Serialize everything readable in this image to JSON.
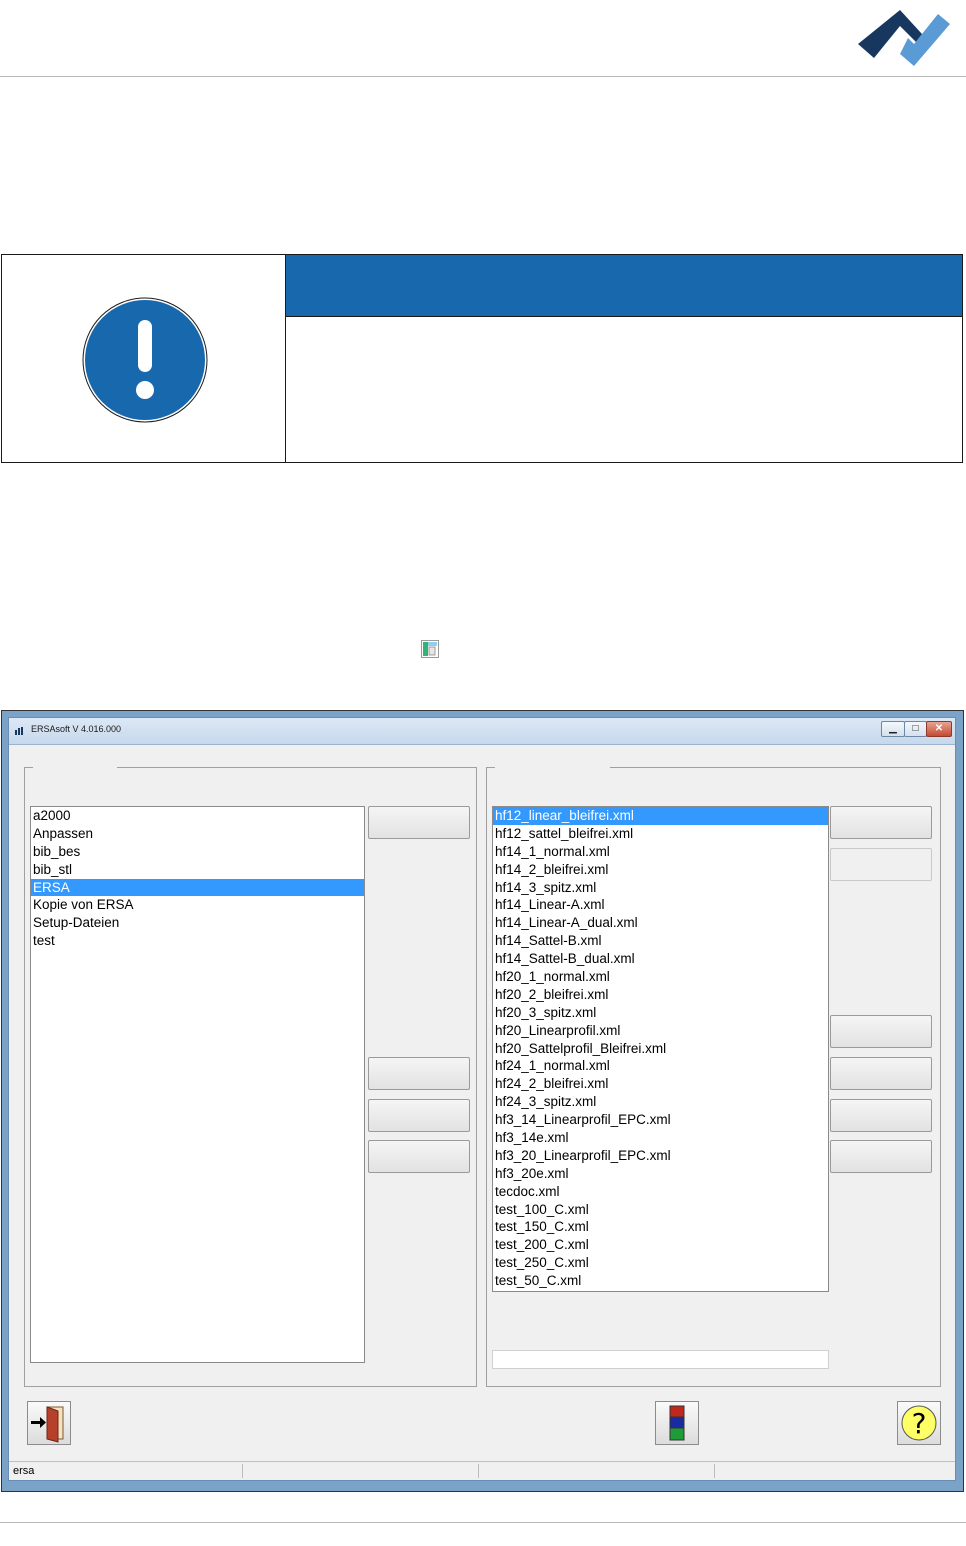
{
  "header": {
    "logo": "brand-check-logo"
  },
  "notice": {
    "icon": "exclamation-icon",
    "accent_color": "#1868ae"
  },
  "inline_icon": "profile-window-icon",
  "app": {
    "title": "ERSAsoft V 4.016.000",
    "window_buttons": {
      "minimize": "▁",
      "maximize": "□",
      "close": "✕"
    },
    "left_list": {
      "items": [
        "a2000",
        "Anpassen",
        "bib_bes",
        "bib_stl",
        "ERSA",
        "Kopie von ERSA",
        "Setup-Dateien",
        "test"
      ],
      "selected": "ERSA"
    },
    "right_list": {
      "items": [
        "hf12_linear_bleifrei.xml",
        "hf12_sattel_bleifrei.xml",
        "hf14_1_normal.xml",
        "hf14_2_bleifrei.xml",
        "hf14_3_spitz.xml",
        "hf14_Linear-A.xml",
        "hf14_Linear-A_dual.xml",
        "hf14_Sattel-B.xml",
        "hf14_Sattel-B_dual.xml",
        "hf20_1_normal.xml",
        "hf20_2_bleifrei.xml",
        "hf20_3_spitz.xml",
        "hf20_Linearprofil.xml",
        "hf20_Sattelprofil_Bleifrei.xml",
        "hf24_1_normal.xml",
        "hf24_2_bleifrei.xml",
        "hf24_3_spitz.xml",
        "hf3_14_Linearprofil_EPC.xml",
        "hf3_14e.xml",
        "hf3_20_Linearprofil_EPC.xml",
        "hf3_20e.xml",
        "tecdoc.xml",
        "test_100_C.xml",
        "test_150_C.xml",
        "test_200_C.xml",
        "test_250_C.xml",
        "test_50_C.xml"
      ],
      "selected": "hf12_linear_bleifrei.xml"
    },
    "bottom_icons": {
      "exit": "exit-door-icon",
      "colors": "color-blocks-icon",
      "help": "help-question-icon"
    },
    "help_glyph": "?",
    "status": {
      "pane1": "ersa",
      "pane2": "",
      "pane3": "",
      "pane4": ""
    }
  }
}
